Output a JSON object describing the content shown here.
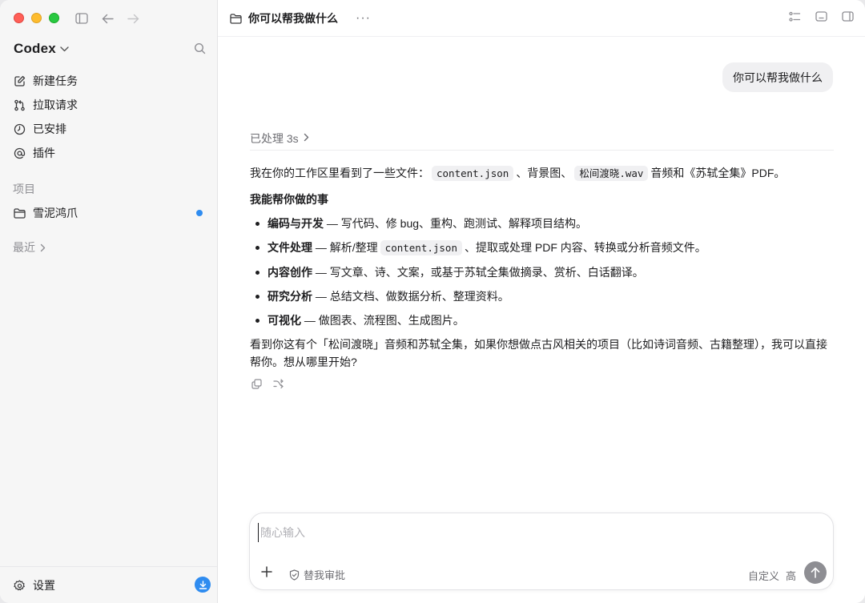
{
  "app": {
    "name": "Codex",
    "colors": {
      "accent": "#2f8cf0",
      "sidebar_bg": "#f6f6f6",
      "bubble_bg": "#f0f0f2",
      "send_button": "#8e8e93"
    }
  },
  "sidebar": {
    "nav": [
      {
        "label": "新建任务",
        "icon": "edit-icon"
      },
      {
        "label": "拉取请求",
        "icon": "pull-request-icon"
      },
      {
        "label": "已安排",
        "icon": "clock-icon"
      },
      {
        "label": "插件",
        "icon": "at-icon"
      }
    ],
    "projects_label": "项目",
    "projects": [
      {
        "label": "雪泥鸿爪",
        "icon": "folder-icon"
      }
    ],
    "recent_label": "最近",
    "settings_label": "设置"
  },
  "header": {
    "title": "你可以帮我做什么",
    "more": "···"
  },
  "conversation": {
    "user_message": "你可以帮我做什么",
    "processed": "已处理 3s",
    "intro": {
      "before": "我在你的工作区里看到了一些文件：",
      "code1": "content.json",
      "mid1": "、背景图、",
      "code2": "松间渡晓.wav",
      "after": "音频和《苏轼全集》PDF。"
    },
    "heading": "我能帮你做的事",
    "bullets": [
      {
        "title": "编码与开发",
        "text": " — 写代码、修 bug、重构、跑测试、解释项目结构。"
      },
      {
        "title": "文件处理",
        "text_before": " — 解析/整理",
        "code": "content.json",
        "text_after": "、提取或处理 PDF 内容、转换或分析音频文件。"
      },
      {
        "title": "内容创作",
        "text": " — 写文章、诗、文案，或基于苏轼全集做摘录、赏析、白话翻译。"
      },
      {
        "title": "研究分析",
        "text": " — 总结文档、做数据分析、整理资料。"
      },
      {
        "title": "可视化",
        "text": " — 做图表、流程图、生成图片。"
      }
    ],
    "closing": "看到你这有个「松间渡晓」音频和苏轼全集，如果你想做点古风相关的项目（比如诗词音频、古籍整理），我可以直接帮你。想从哪里开始?"
  },
  "composer": {
    "placeholder": "随心输入",
    "value": "",
    "approval_label": "替我审批",
    "mode_label": "自定义",
    "level_label": "高"
  }
}
